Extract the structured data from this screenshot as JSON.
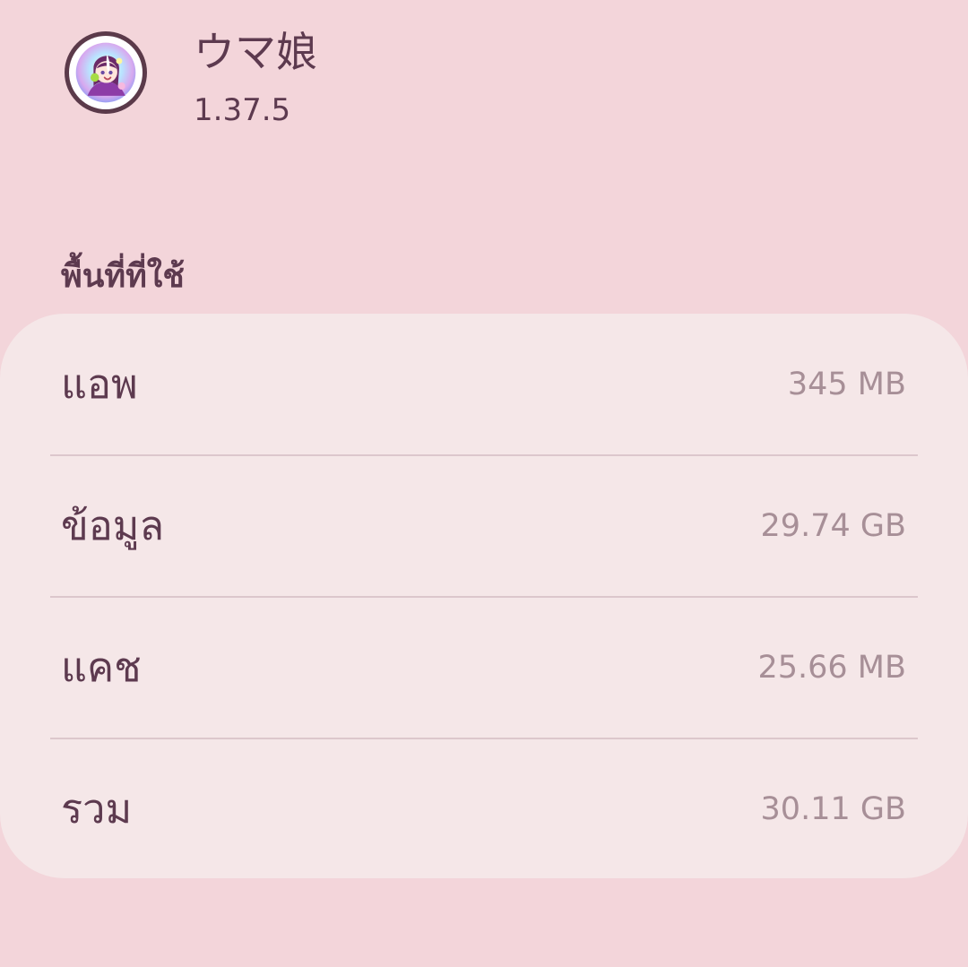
{
  "app": {
    "name": "ウマ娘",
    "version": "1.37.5",
    "icon": "app-character-icon"
  },
  "storage": {
    "section_title": "พื้นที่ที่ใช้",
    "rows": [
      {
        "label": "แอพ",
        "value": "345 MB"
      },
      {
        "label": "ข้อมูล",
        "value": "29.74 GB"
      },
      {
        "label": "แคช",
        "value": "25.66 MB"
      },
      {
        "label": "รวม",
        "value": "30.11 GB"
      }
    ]
  },
  "colors": {
    "background": "#f3d5da",
    "card": "#f5e7e8",
    "primary_text": "#5d3a4f",
    "secondary_text": "#a78f97",
    "divider": "#dcc7cc"
  }
}
